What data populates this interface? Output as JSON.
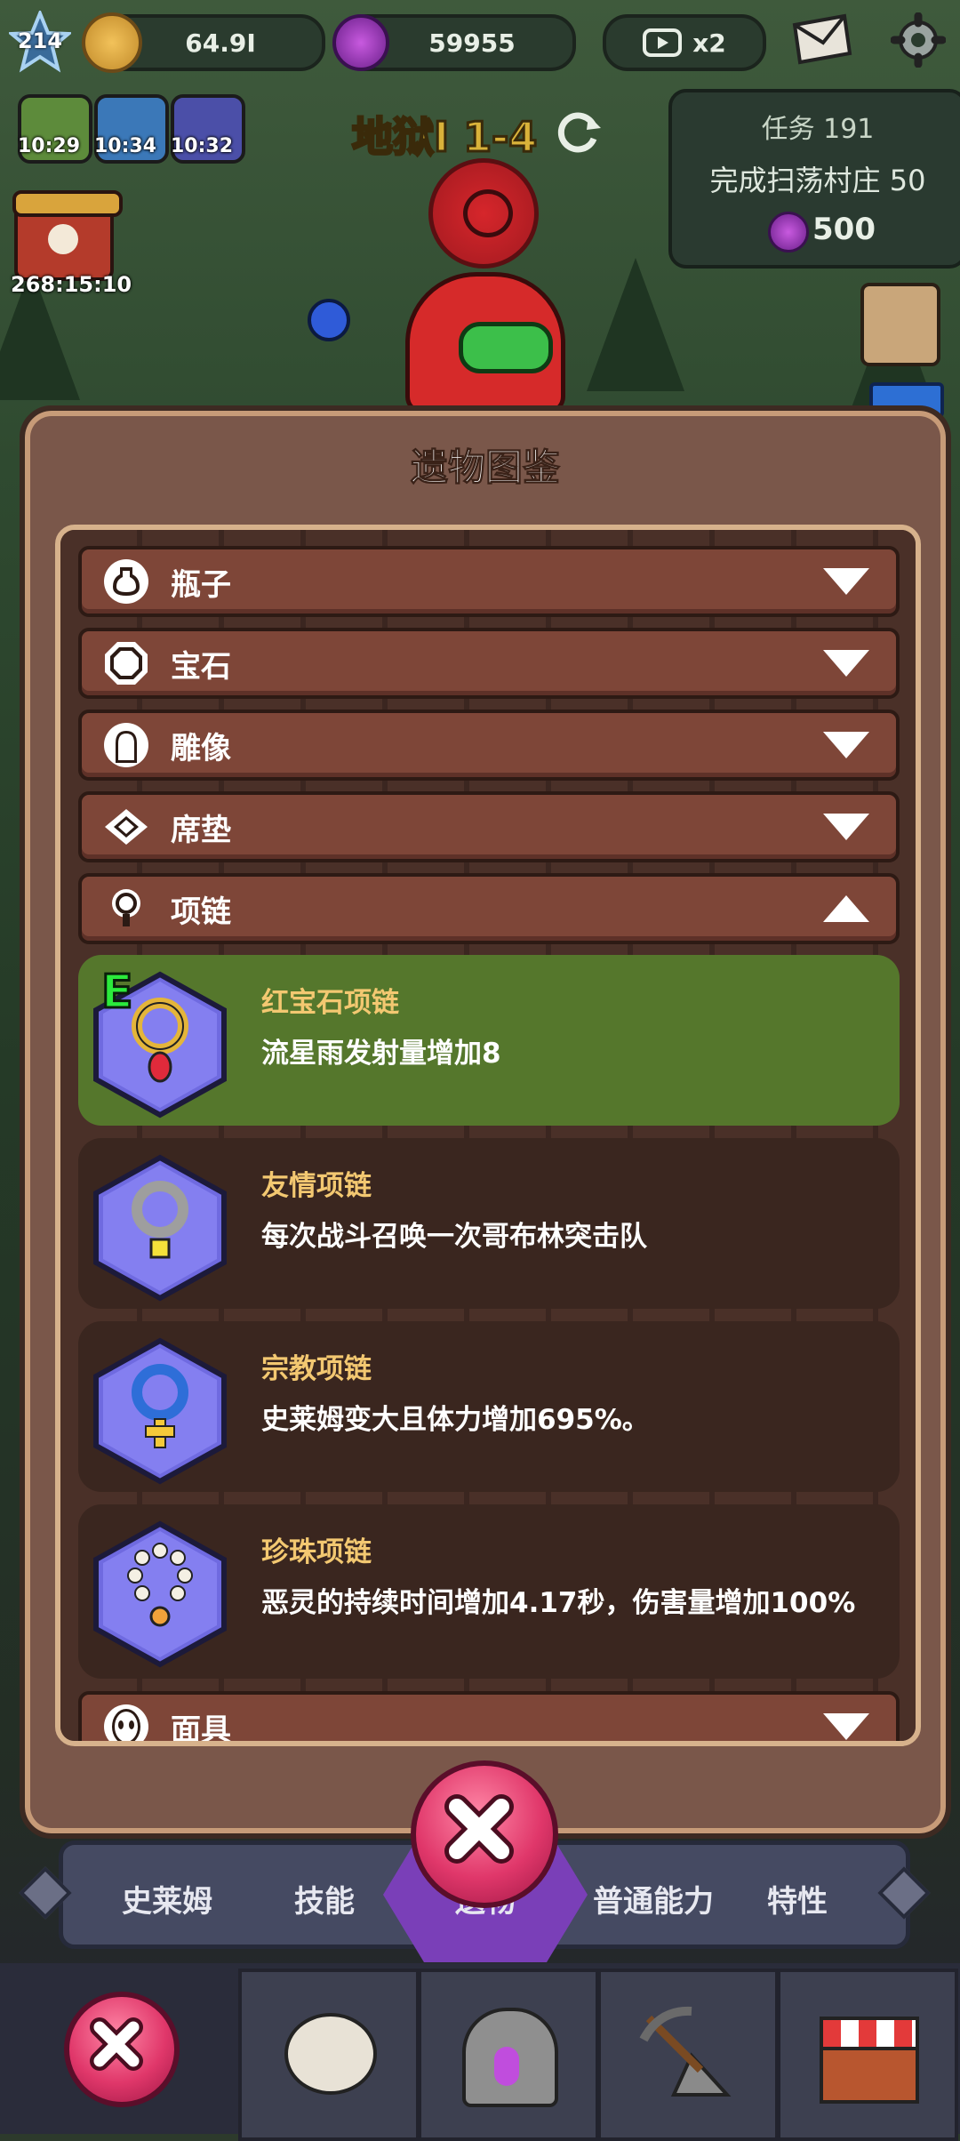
{
  "top_bar": {
    "level": "214",
    "gold": "64.9I",
    "gems": "59955",
    "video_multiplier": "x2"
  },
  "buffs": [
    {
      "name": "gold-buff",
      "time": "10:29"
    },
    {
      "name": "attack-buff",
      "time": "10:34"
    },
    {
      "name": "speed-buff",
      "time": "10:32"
    }
  ],
  "event_timer": "268:15:10",
  "stage": "地狱I 1-4",
  "quest": {
    "title": "任务 191",
    "description": "完成扫荡村庄 50",
    "reward": "500"
  },
  "dialog": {
    "title": "遗物图鉴",
    "categories": [
      {
        "label": "瓶子",
        "icon": "bottle-icon",
        "expanded": false
      },
      {
        "label": "宝石",
        "icon": "gem-icon",
        "expanded": false
      },
      {
        "label": "雕像",
        "icon": "statue-icon",
        "expanded": false
      },
      {
        "label": "席垫",
        "icon": "mat-icon",
        "expanded": false
      },
      {
        "label": "项链",
        "icon": "necklace-icon",
        "expanded": true
      }
    ],
    "items": [
      {
        "name": "红宝石项链",
        "description": "流星雨发射量增加8",
        "badge": "E",
        "equipped": true,
        "color": "#e4b53a"
      },
      {
        "name": "友情项链",
        "description": "每次战斗召唤一次哥布林突击队",
        "color": "#9e9e9e"
      },
      {
        "name": "宗教项链",
        "description": "史莱姆变大且体力增加695%。",
        "color": "#2e6ed8"
      },
      {
        "name": "珍珠项链",
        "description": "恶灵的持续时间增加4.17秒，伤害量增加100%",
        "color": "#f4f0e4"
      }
    ],
    "last_category": {
      "label": "面具",
      "icon": "mask-icon",
      "expanded": false
    }
  },
  "tabs": [
    "史莱姆",
    "技能",
    "遗物",
    "普通能力",
    "特性"
  ],
  "colors": {
    "accent_red": "#e0376a",
    "panel_brown": "#7a574a",
    "selected_green": "#55772c",
    "item_name_gold": "#f3c871"
  }
}
